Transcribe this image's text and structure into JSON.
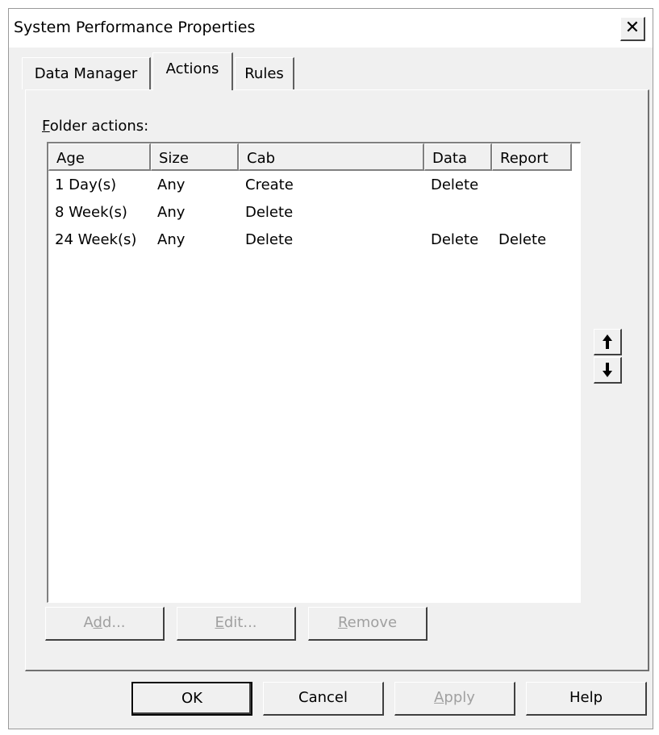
{
  "window": {
    "title": "System Performance Properties",
    "close_glyph": "✕"
  },
  "tabs": [
    {
      "label": "Data Manager",
      "active": false
    },
    {
      "label": "Actions",
      "active": true
    },
    {
      "label": "Rules",
      "active": false
    }
  ],
  "folder_actions": {
    "label_accel": "F",
    "label_rest": "older actions:",
    "columns": [
      "Age",
      "Size",
      "Cab",
      "Data",
      "Report"
    ],
    "rows": [
      [
        "1 Day(s)",
        "Any",
        "Create",
        "Delete",
        ""
      ],
      [
        "8 Week(s)",
        "Any",
        "Delete",
        "",
        ""
      ],
      [
        "24 Week(s)",
        "Any",
        "Delete",
        "Delete",
        "Delete"
      ]
    ]
  },
  "move_buttons": {
    "up_icon": "up-arrow-icon",
    "down_icon": "down-arrow-icon",
    "up_glyph": "🠕",
    "down_glyph": "🠗"
  },
  "list_buttons": {
    "add": {
      "pre": "A",
      "accel": "d",
      "post": "d..."
    },
    "edit": {
      "pre": "",
      "accel": "E",
      "post": "dit..."
    },
    "remove": {
      "pre": "",
      "accel": "R",
      "post": "emove"
    }
  },
  "dialog_buttons": {
    "ok": "OK",
    "cancel": "Cancel",
    "apply_accel": "A",
    "apply_rest": "pply",
    "help": "Help"
  },
  "colors": {
    "dialog_bg": "#f0f0f0",
    "disabled_text": "#a0a0a0"
  }
}
